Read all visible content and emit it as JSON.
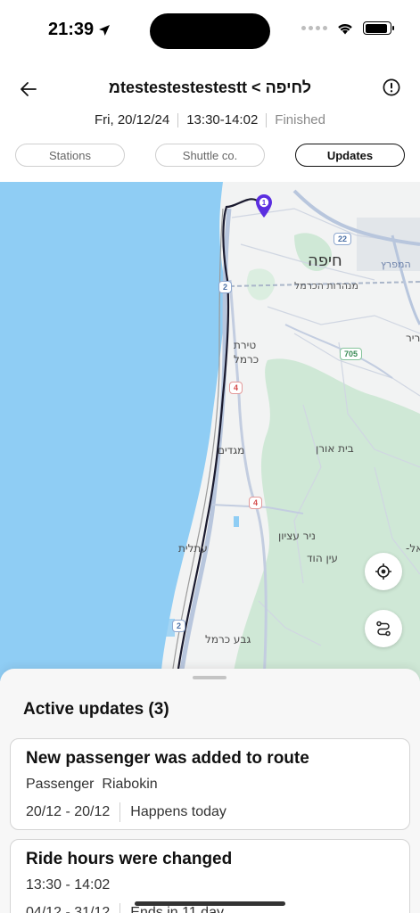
{
  "status_bar": {
    "time": "21:39",
    "icons": [
      "location-arrow-icon",
      "signal-dots-icon",
      "wifi-icon",
      "battery-icon"
    ],
    "battery_level": 0.9
  },
  "header": {
    "back_icon": "arrow-left-icon",
    "title": "מtestestestestestt < לחיפה",
    "info_icon": "exclamation-circle-icon",
    "date": "Fri, 20/12/24",
    "time_range": "13:30-14:02",
    "status": "Finished"
  },
  "tabs": [
    {
      "label": "Stations",
      "active": false
    },
    {
      "label": "Shuttle co.",
      "active": false
    },
    {
      "label": "Updates",
      "active": true
    }
  ],
  "map": {
    "labels": {
      "haifa": "חיפה",
      "tirat_carmel_1": "טירת",
      "tirat_carmel_2": "כרמל",
      "megadim": "מגדים",
      "beit_oren": "בית אורן",
      "nir_etzion": "ניר עציון",
      "ein_hod": "עין הוד",
      "atlit": "עתלית",
      "geva_carmel": "גבע כרמל",
      "carmel_tunnels": "מנהרות הכרמל",
      "edge_1": "ריר",
      "edge_2": "אל-",
      "edge_3": "המפרץ"
    },
    "road_shields": [
      "22",
      "2",
      "705",
      "4",
      "4",
      "2"
    ],
    "station_marker": "1",
    "colors": {
      "sea": "#8fcdf4",
      "land": "#f2f3f3",
      "forest": "#cfe8d6",
      "route": "#1a1a2e",
      "marker": "#5b2ee0"
    }
  },
  "map_controls": [
    {
      "icon": "crosshair-icon"
    },
    {
      "icon": "route-icon"
    }
  ],
  "updates": {
    "title": "Active updates (3)",
    "cards": [
      {
        "title": "New passenger was added to route",
        "detail": "Passenger  Riabokin",
        "dates": "20/12 - 20/12",
        "note": "Happens today"
      },
      {
        "title": "Ride hours were changed",
        "detail": "13:30 - 14:02",
        "dates": "04/12 - 31/12",
        "note": "Ends in 11 day"
      }
    ]
  }
}
